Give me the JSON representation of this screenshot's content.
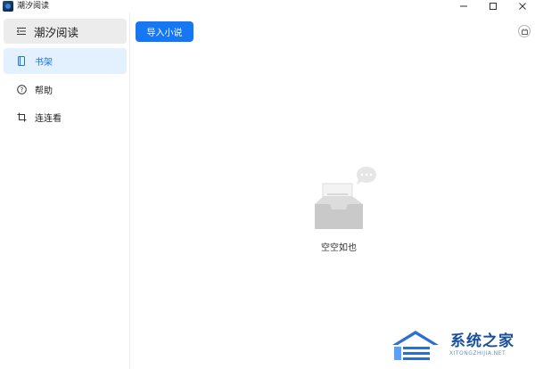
{
  "window": {
    "title": "潮汐阅读",
    "controls": {
      "minimize": "minimize",
      "maximize": "maximize",
      "close": "close"
    }
  },
  "sidebar": {
    "header": {
      "label": "潮汐阅读",
      "icon": "menu-icon"
    },
    "items": [
      {
        "label": "书架",
        "icon": "bookshelf-icon",
        "active": true
      },
      {
        "label": "帮助",
        "icon": "help-icon",
        "active": false
      },
      {
        "label": "连连看",
        "icon": "crop-icon",
        "active": false
      }
    ]
  },
  "main": {
    "import_button": "导入小说",
    "empty_text": "空空如也"
  },
  "watermark": {
    "title": "系统之家",
    "subtitle": "XITONGZHIJIA.NET"
  },
  "colors": {
    "accent": "#1677f4",
    "active_bg": "#e3f0fd",
    "header_bg": "#ececec"
  }
}
